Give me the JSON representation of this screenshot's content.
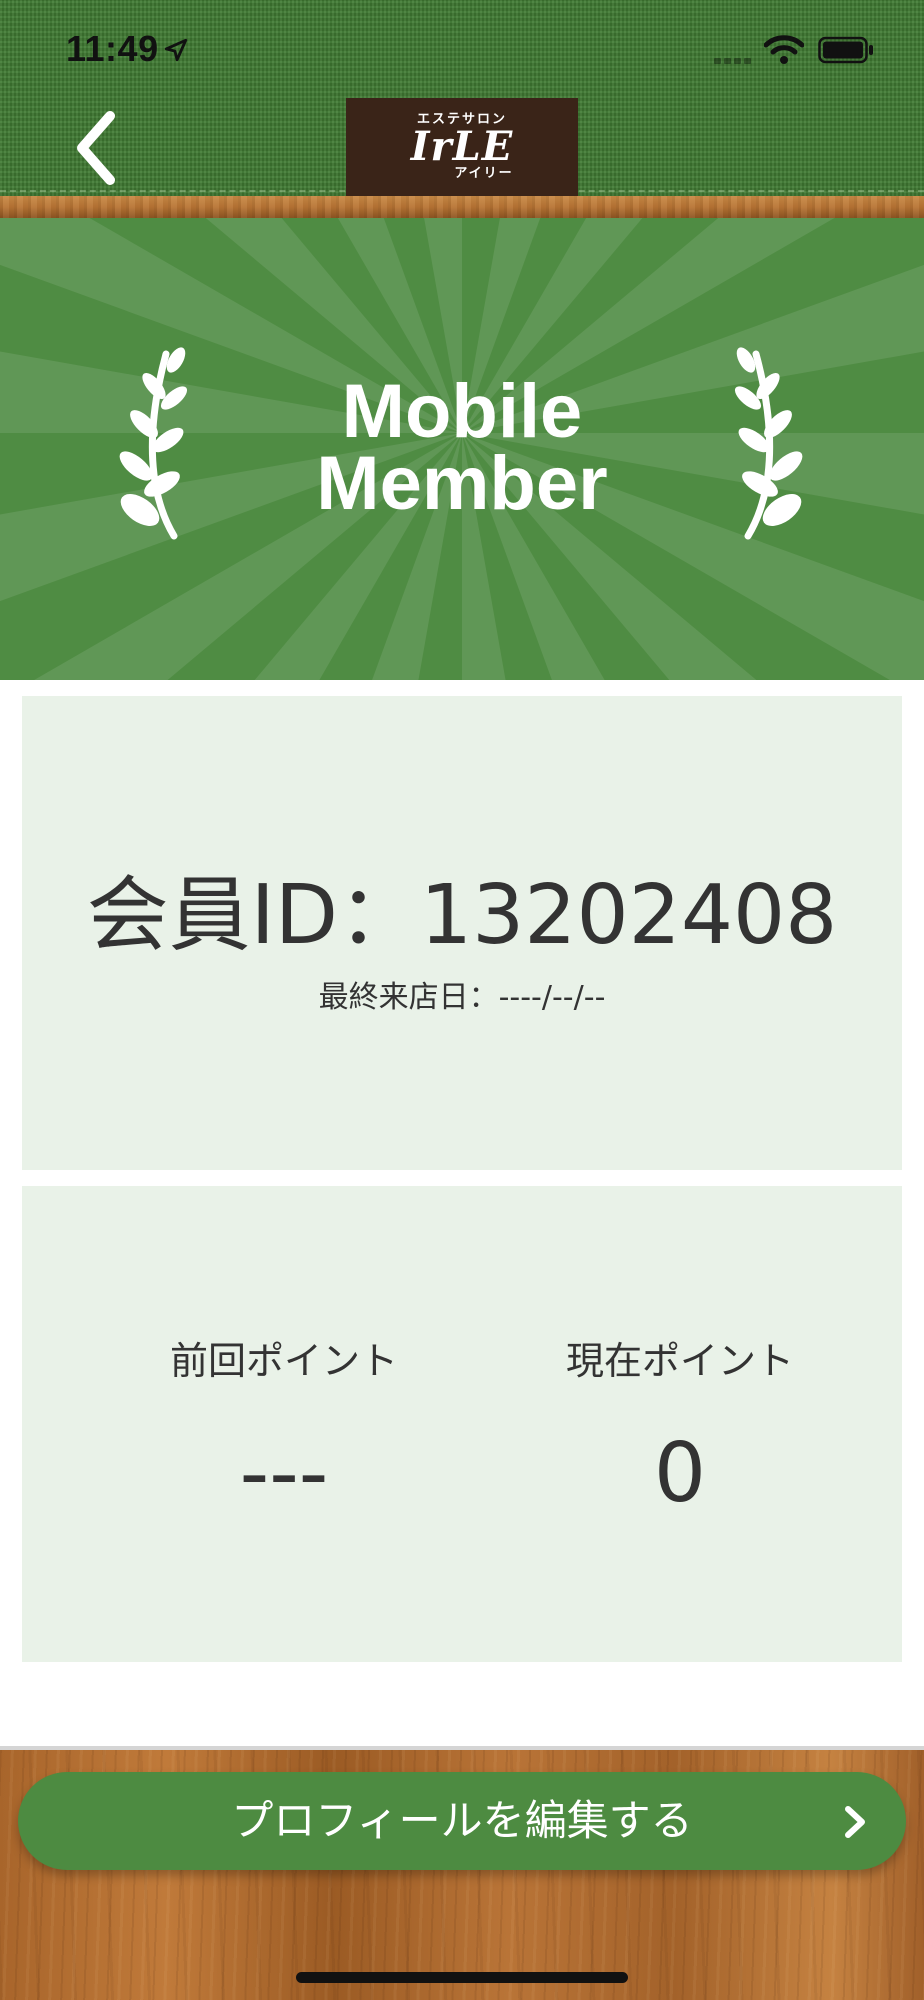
{
  "status_bar": {
    "time": "11:49",
    "location_icon": "location-arrow-icon",
    "signal_icon": "cellular-signal-icon",
    "wifi_icon": "wifi-icon",
    "battery_icon": "battery-full-icon"
  },
  "nav": {
    "back_icon": "chevron-left-icon",
    "logo": {
      "top_text": "エステサロン",
      "main_text": "IrLE",
      "sub_text": "アイリー"
    }
  },
  "banner": {
    "title_line1": "Mobile",
    "title_line2": "Member",
    "decor_icon": "laurel-branch-icon"
  },
  "member": {
    "id_text": "会員ID：13202408",
    "last_visit_text": "最終来店日：----/--/--"
  },
  "points": {
    "previous_label": "前回ポイント",
    "previous_value": "---",
    "current_label": "現在ポイント",
    "current_value": "0"
  },
  "footer": {
    "edit_button_label": "プロフィールを編集する",
    "chevron_icon": "chevron-right-icon"
  },
  "colors": {
    "header_green": "#3f7a32",
    "banner_green": "#4f8c43",
    "card_bg": "#e9f2e8",
    "button_green": "#4d8b41",
    "logo_brown": "#3a2418",
    "text_dark": "#333333"
  }
}
